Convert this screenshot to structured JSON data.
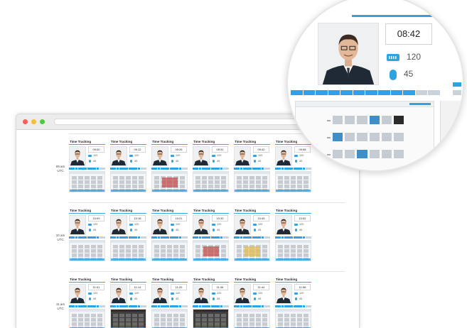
{
  "card_title": "Time Tracking",
  "keyboard_icon": "keyboard-icon",
  "mouse_icon": "mouse-icon",
  "accent_color": "#2ea3e3",
  "hours": [
    {
      "label_line1": "09 am",
      "label_line2": "UTC",
      "cards": [
        {
          "time": "09:00",
          "keys": "120",
          "clicks": "45"
        },
        {
          "time": "09:12",
          "keys": "120",
          "clicks": "45"
        },
        {
          "time": "09:26",
          "keys": "120",
          "clicks": "45"
        },
        {
          "time": "09:31",
          "keys": "120",
          "clicks": "45"
        },
        {
          "time": "09:42",
          "keys": "120",
          "clicks": "45"
        },
        {
          "time": "09:58",
          "keys": "120",
          "clicks": "45"
        }
      ]
    },
    {
      "label_line1": "10 am",
      "label_line2": "UTC",
      "cards": [
        {
          "time": "10:09",
          "keys": "120",
          "clicks": "45"
        },
        {
          "time": "10:16",
          "keys": "120",
          "clicks": "45"
        },
        {
          "time": "10:21",
          "keys": "120",
          "clicks": "45"
        },
        {
          "time": "10:33",
          "keys": "120",
          "clicks": "45"
        },
        {
          "time": "10:45",
          "keys": "120",
          "clicks": "45"
        },
        {
          "time": "10:52",
          "keys": "120",
          "clicks": "45"
        }
      ]
    },
    {
      "label_line1": "11 am",
      "label_line2": "UTC",
      "cards": [
        {
          "time": "11:01",
          "keys": "120",
          "clicks": "45"
        },
        {
          "time": "11:14",
          "keys": "120",
          "clicks": "45"
        },
        {
          "time": "11:20",
          "keys": "120",
          "clicks": "45"
        },
        {
          "time": "11:36",
          "keys": "120",
          "clicks": "45"
        },
        {
          "time": "11:44",
          "keys": "120",
          "clicks": "45"
        },
        {
          "time": "11:56",
          "keys": "120",
          "clicks": "45"
        }
      ]
    }
  ],
  "magnifier": {
    "time": "08:42",
    "keys": "120",
    "clicks": "45"
  }
}
